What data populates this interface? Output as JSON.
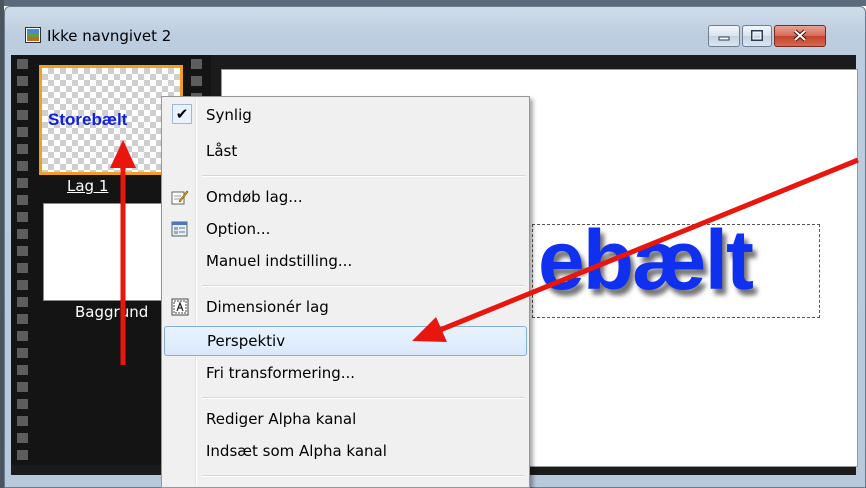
{
  "window": {
    "title": "Ikke navngivet 2",
    "icons": {
      "app": "image-document-icon",
      "minimize": "minimize-icon",
      "maximize": "maximize-icon",
      "close": "close-icon"
    }
  },
  "layers": [
    {
      "label": "Lag 1",
      "preview_text": "Storebælt",
      "selected": true
    },
    {
      "label": "Baggrund",
      "selected": false
    }
  ],
  "canvas": {
    "text": "ebælt"
  },
  "context_menu": {
    "items": [
      {
        "label": "Synlig",
        "checked": true
      },
      {
        "label": "Låst"
      },
      {
        "label": "Omdøb lag...",
        "icon": "rename-icon"
      },
      {
        "label": "Option...",
        "icon": "options-icon"
      },
      {
        "label": "Manuel indstilling..."
      },
      {
        "label": "Dimensionér lag",
        "icon": "resize-layer-icon"
      },
      {
        "label": "Perspektiv",
        "highlighted": true
      },
      {
        "label": "Fri transformering..."
      },
      {
        "label": "Rediger Alpha kanal"
      },
      {
        "label": "Indsæt som Alpha kanal"
      }
    ]
  },
  "colors": {
    "arrow": "#e8160c",
    "layer_select": "#f0a020",
    "text_blue": "#1030f0",
    "menu_hover_border": "#82aee0"
  }
}
